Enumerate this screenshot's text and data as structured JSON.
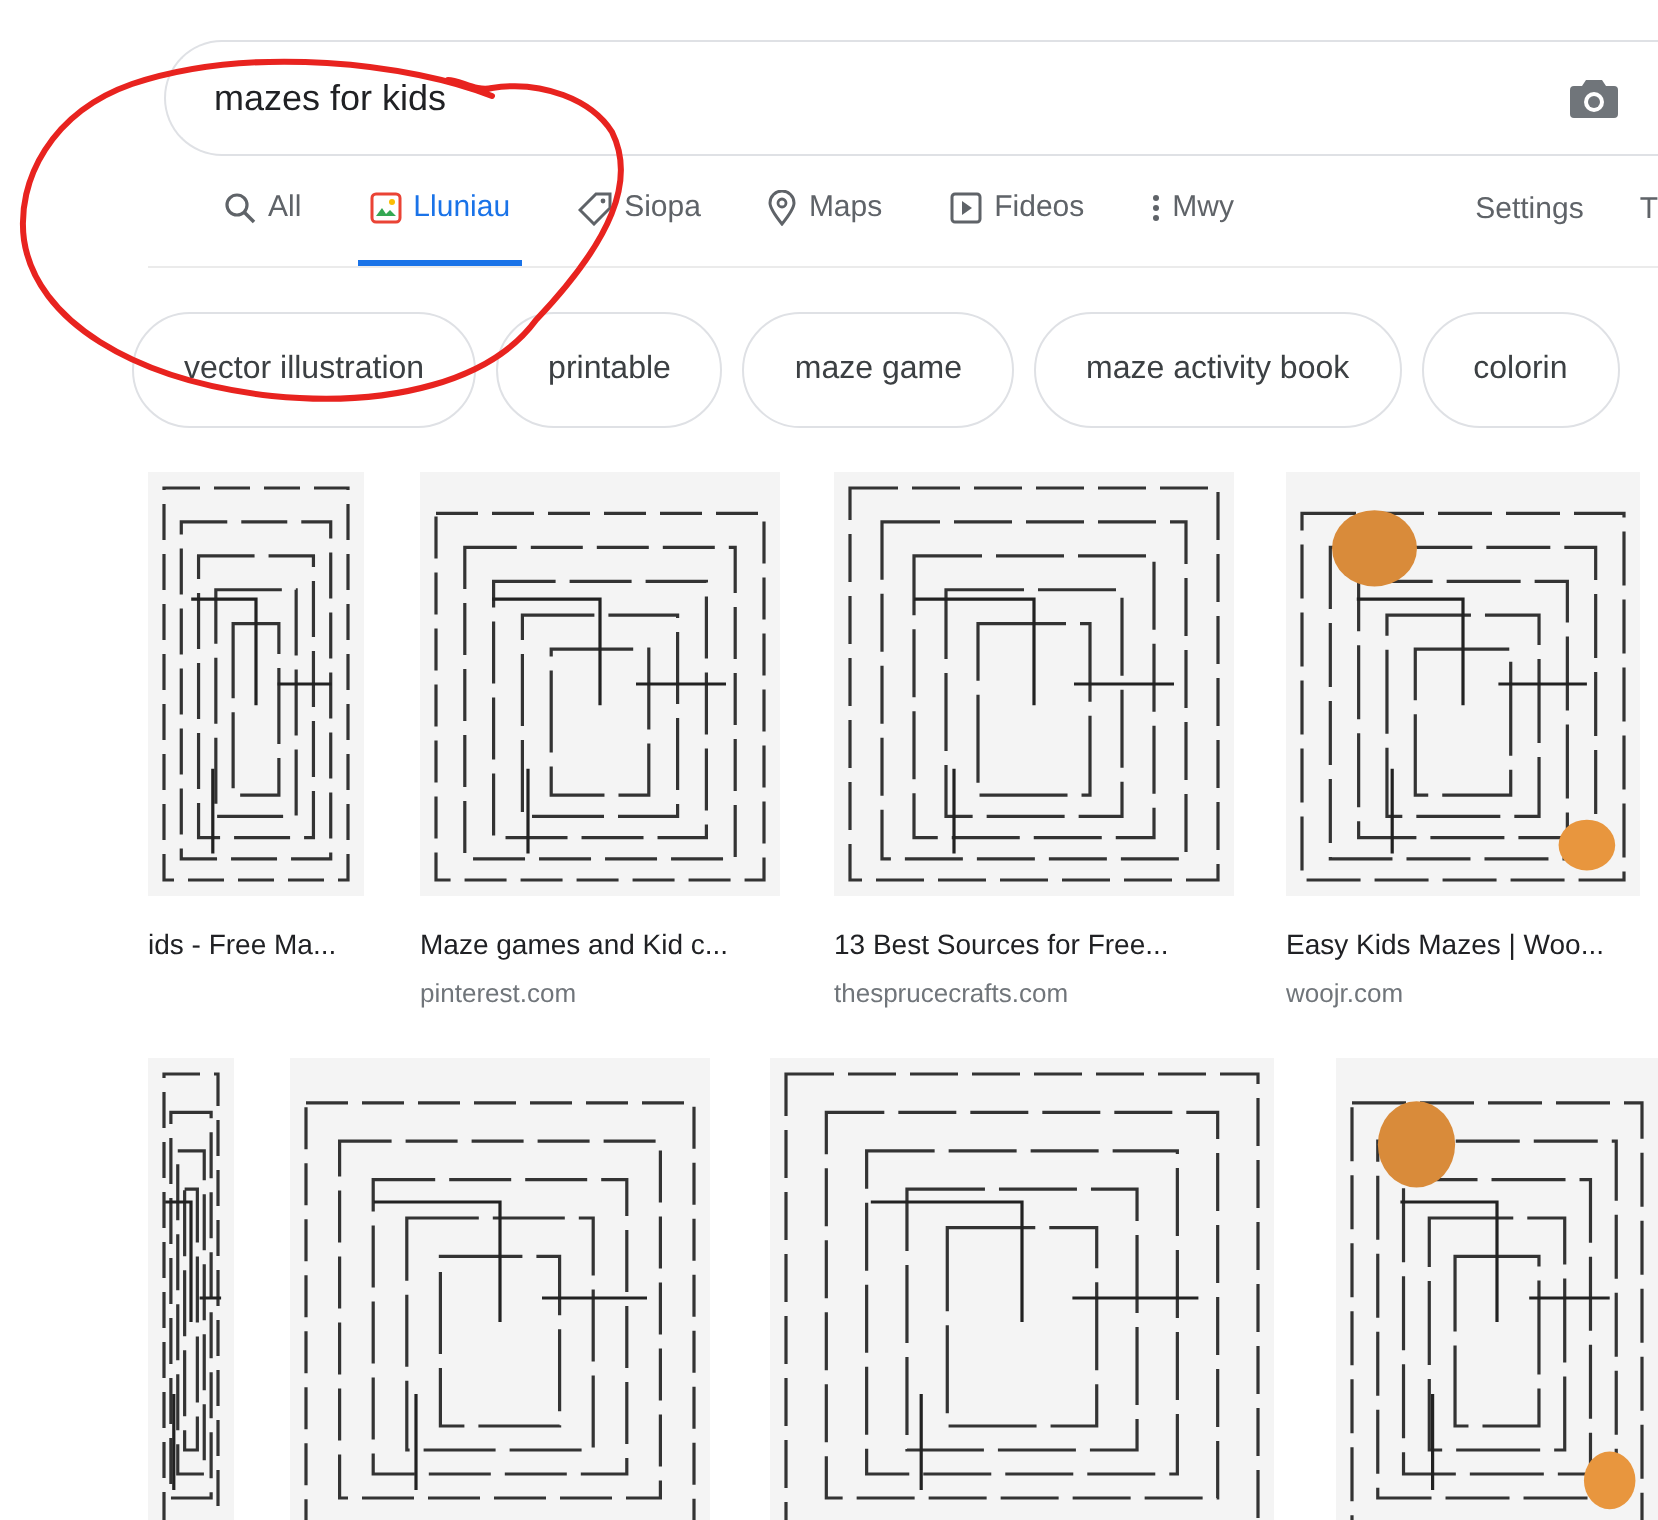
{
  "search": {
    "value": "mazes for kids"
  },
  "tabs": [
    {
      "label": "All",
      "kind": "search",
      "selected": false
    },
    {
      "label": "Lluniau",
      "kind": "images",
      "selected": true
    },
    {
      "label": "Siopa",
      "kind": "shopping",
      "selected": false
    },
    {
      "label": "Maps",
      "kind": "maps",
      "selected": false
    },
    {
      "label": "Fideos",
      "kind": "videos",
      "selected": false
    },
    {
      "label": "Mwy",
      "kind": "more",
      "selected": false
    }
  ],
  "tools": [
    "Settings",
    "T"
  ],
  "chips": [
    "vector illustration",
    "printable",
    "maze game",
    "maze activity book",
    "colorin"
  ],
  "image_rows": [
    [
      {
        "title": "ids - Free Ma..."
      },
      {
        "title": "Maze games and Kid c...",
        "source": "pinterest.com"
      },
      {
        "title": "13 Best Sources for Free...",
        "source": "thesprucecrafts.com"
      },
      {
        "title": "Easy Kids Mazes | Woo...",
        "source": "woojr.com"
      }
    ],
    [
      {
        "kind": "picture"
      },
      {
        "kind": "picture"
      },
      {
        "kind": "picture"
      },
      {
        "kind": "picture"
      }
    ]
  ]
}
